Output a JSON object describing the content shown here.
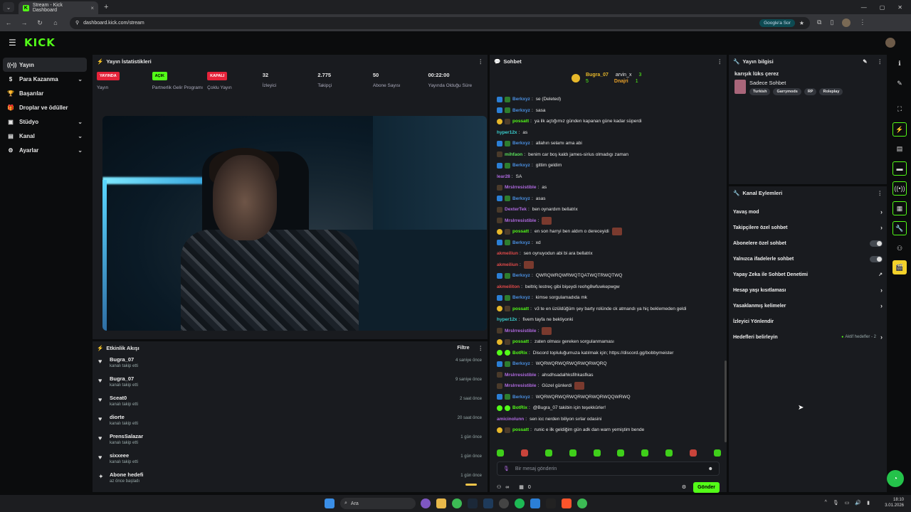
{
  "browser": {
    "tab_title": "Stream - Kick Dashboard",
    "tab_close": "×",
    "new_tab": "+",
    "url": "dashboard.kick.com/stream",
    "google_sor": "Google'a Sor"
  },
  "brand": {
    "logo": "KICK"
  },
  "nav": {
    "items": [
      {
        "label": "Yayın",
        "icon": "broadcast-icon",
        "glyph": "((•))",
        "chevron": ""
      },
      {
        "label": "Para Kazanma",
        "icon": "money-icon",
        "glyph": "$",
        "chevron": "⌄"
      },
      {
        "label": "Başarılar",
        "icon": "trophy-icon",
        "glyph": "🏆",
        "chevron": ""
      },
      {
        "label": "Droplar ve ödüller",
        "icon": "gift-icon",
        "glyph": "🎁",
        "chevron": ""
      },
      {
        "label": "Stüdyo",
        "icon": "studio-icon",
        "glyph": "▣",
        "chevron": "⌄"
      },
      {
        "label": "Kanal",
        "icon": "channel-icon",
        "glyph": "▤",
        "chevron": "⌄"
      },
      {
        "label": "Ayarlar",
        "icon": "gear-icon",
        "glyph": "⚙",
        "chevron": "⌄"
      }
    ]
  },
  "stats": {
    "title": "Yayın İstatistikleri",
    "items": [
      {
        "value": "YAYINDA",
        "label": "Yayın",
        "kind": "badge-red"
      },
      {
        "value": "AÇIK",
        "label": "Partnerlik Gelir Programı",
        "kind": "badge-green"
      },
      {
        "value": "KAPALI",
        "label": "Çoklu Yayın",
        "kind": "badge-red"
      },
      {
        "value": "32",
        "label": "İzleyici",
        "kind": "num"
      },
      {
        "value": "2.775",
        "label": "Takipçi",
        "kind": "num"
      },
      {
        "value": "50",
        "label": "Abone Sayısı",
        "kind": "num"
      },
      {
        "value": "00:22:00",
        "label": "Yayında Olduğu Süre",
        "kind": "num"
      }
    ]
  },
  "feed": {
    "title": "Etkinlik Akışı",
    "filter": "Filtre",
    "items": [
      {
        "name": "Bugra_07",
        "sub": "kanalı takip etti",
        "time": "4 saniye önce",
        "icon": "♥"
      },
      {
        "name": "Bugra_07",
        "sub": "kanalı takip etti",
        "time": "9 saniye önce",
        "icon": "♥"
      },
      {
        "name": "Sceat0",
        "sub": "kanalı takip etti",
        "time": "2 saat önce",
        "icon": "♥"
      },
      {
        "name": "diorte",
        "sub": "kanalı takip etti",
        "time": "20 saat önce",
        "icon": "♥"
      },
      {
        "name": "PrensSalazar",
        "sub": "kanalı takip etti",
        "time": "1 gün önce",
        "icon": "♥"
      },
      {
        "name": "sixxeee",
        "sub": "kanalı takip etti",
        "time": "1 gün önce",
        "icon": "♥"
      },
      {
        "name": "Abone hedefi",
        "sub": "az önce başladı",
        "time": "1 gün önce",
        "icon": "✦"
      }
    ]
  },
  "chat": {
    "title": "Sohbet",
    "top_users": [
      {
        "name": "Bugra_07",
        "count": "5"
      },
      {
        "name": "arvin_x",
        "count": "3"
      },
      {
        "name": "Dnajri",
        "count": "1"
      }
    ],
    "messages": [
      {
        "user": "Berkxyz",
        "color": "#4a8fe0",
        "badges": [
          "mod",
          "sub"
        ],
        "text": "se (Deleted)",
        "emote": false
      },
      {
        "user": "Berkxyz",
        "color": "#4a8fe0",
        "badges": [
          "mod",
          "sub"
        ],
        "text": "sasa",
        "emote": false
      },
      {
        "user": "possatt",
        "color": "#53fc18",
        "badges": [
          "gold",
          "vip"
        ],
        "text": "ya ilk açtığımız günden kapanan güne kadar süperdi",
        "emote": false
      },
      {
        "user": "hyper12x",
        "color": "#3ad0d0",
        "badges": [],
        "text": "as",
        "emote": false
      },
      {
        "user": "Berkxyz",
        "color": "#4a8fe0",
        "badges": [
          "mod",
          "sub"
        ],
        "text": "allahın selamı ama abi",
        "emote": false
      },
      {
        "user": "mihfaon",
        "color": "#5ae05a",
        "badges": [
          "vip"
        ],
        "text": "benim car boş kaldı james-sirius olmadıgı zaman",
        "emote": false
      },
      {
        "user": "Berkxyz",
        "color": "#4a8fe0",
        "badges": [
          "mod",
          "sub"
        ],
        "text": "gittim geldim",
        "emote": false
      },
      {
        "user": "lear28",
        "color": "#b06ae0",
        "badges": [],
        "text": "SA",
        "emote": false
      },
      {
        "user": "Mrslrresistible",
        "color": "#b06ae0",
        "badges": [
          "vip"
        ],
        "text": "as",
        "emote": false
      },
      {
        "user": "Berkxyz",
        "color": "#4a8fe0",
        "badges": [
          "mod",
          "sub"
        ],
        "text": "asas",
        "emote": false
      },
      {
        "user": "DexterTek",
        "color": "#b06ae0",
        "badges": [
          "vip"
        ],
        "text": "ben oynardım bellatrix",
        "emote": false
      },
      {
        "user": "Mrslrresistible",
        "color": "#b06ae0",
        "badges": [
          "vip"
        ],
        "text": "",
        "emote": true
      },
      {
        "user": "possatt",
        "color": "#53fc18",
        "badges": [
          "gold",
          "vip"
        ],
        "text": "en son harryi ben aldım o dereceyidi",
        "emote": true
      },
      {
        "user": "Berkxyz",
        "color": "#4a8fe0",
        "badges": [
          "mod",
          "sub"
        ],
        "text": "xd",
        "emote": false
      },
      {
        "user": "akmeiliun",
        "color": "#e04a4a",
        "badges": [],
        "text": "sen oynuyodun abi bi ara bellatrix",
        "emote": false
      },
      {
        "user": "akmeiliun",
        "color": "#e04a4a",
        "badges": [],
        "text": "",
        "emote": true
      },
      {
        "user": "Berkxyz",
        "color": "#4a8fe0",
        "badges": [
          "mod",
          "sub"
        ],
        "text": "QWRQWRQWRWQTQATWQTRWQTWQ",
        "emote": false
      },
      {
        "user": "akmeiliton",
        "color": "#e04a4a",
        "badges": [],
        "text": "beltriç lestreç gibi bişeydi reohg8wfuwkepwgw",
        "emote": false
      },
      {
        "user": "Berkxyz",
        "color": "#4a8fe0",
        "badges": [
          "mod",
          "sub"
        ],
        "text": "kimse sorgulamadıda mk",
        "emote": false
      },
      {
        "user": "possatt",
        "color": "#53fc18",
        "badges": [
          "gold",
          "vip"
        ],
        "text": "v3 te en üzüldüğüm şey barty rolünde ck atmandı ya hiç beklemeden geldi",
        "emote": false
      },
      {
        "user": "hyper12x",
        "color": "#3ad0d0",
        "badges": [],
        "text": "fivem tayfa ne bekliyonki",
        "emote": false
      },
      {
        "user": "Mrslrresistible",
        "color": "#b06ae0",
        "badges": [
          "vip"
        ],
        "text": "",
        "emote": true
      },
      {
        "user": "possatt",
        "color": "#53fc18",
        "badges": [
          "gold",
          "vip"
        ],
        "text": "zaten olması gereken sorgulanmaması",
        "emote": false
      },
      {
        "user": "BotRix",
        "color": "#53fc18",
        "badges": [
          "bot",
          "bot"
        ],
        "text": "Discord topluluğumuza katılmak için; https://discord.gg/bobbymeister",
        "emote": false
      },
      {
        "user": "Berkxyz",
        "color": "#4a8fe0",
        "badges": [
          "mod",
          "sub"
        ],
        "text": "WQRWQRWQRWQRWQRWQRQ",
        "emote": false
      },
      {
        "user": "Mrslrresistible",
        "color": "#b06ae0",
        "badges": [
          "vip"
        ],
        "text": "ahsdhsadalhksfihkasfkas",
        "emote": false
      },
      {
        "user": "Mrslrresistible",
        "color": "#b06ae0",
        "badges": [
          "vip"
        ],
        "text": "Güzel günlerdi",
        "emote": true
      },
      {
        "user": "Berkxyz",
        "color": "#4a8fe0",
        "badges": [
          "mod",
          "sub"
        ],
        "text": "WQRWQRWQRWQRWQRWQRWQQWRWQ",
        "emote": false
      },
      {
        "user": "BotRix",
        "color": "#53fc18",
        "badges": [
          "bot",
          "bot"
        ],
        "text": "@Bugra_07 takibin için teşekkürler!",
        "emote": false
      },
      {
        "user": "amicinolunn",
        "color": "#b06ae0",
        "badges": [],
        "text": "sen icc nerden biliyon sırlar odasini",
        "emote": false
      },
      {
        "user": "possatt",
        "color": "#53fc18",
        "badges": [
          "gold",
          "vip"
        ],
        "text": "runic e ilk geldiğim gün adk dan warn yemiştim bende",
        "emote": false
      }
    ],
    "input_placeholder": "Bir mesaj gönderin",
    "footer_infinity": "∞",
    "footer_count": "0",
    "send": "Gönder"
  },
  "stream_info": {
    "title": "Yayın bilgisi",
    "stream_title": "karışık lüks çerez",
    "category": "Sadece Sohbet",
    "tags": [
      "Turkish",
      "Garrymods",
      "RP",
      "Roleplay"
    ]
  },
  "channel_actions": {
    "title": "Kanal Eylemleri",
    "items": [
      {
        "label": "Yavaş mod",
        "control": "arrow"
      },
      {
        "label": "Takipçilere özel sohbet",
        "control": "arrow"
      },
      {
        "label": "Abonelere özel sohbet",
        "control": "toggle"
      },
      {
        "label": "Yalnızca ifadelerle sohbet",
        "control": "toggle"
      },
      {
        "label": "Yapay Zeka ile Sohbet Denetimi",
        "control": "external"
      },
      {
        "label": "Hesap yaşı kısıtlaması",
        "control": "arrow"
      },
      {
        "label": "Yasaklanmış kelimeler",
        "control": "arrow"
      },
      {
        "label": "İzleyici Yönlendir",
        "control": "none"
      },
      {
        "label": "Hedefleri belirleyin",
        "control": "arrow",
        "note": "Aktif hedefler - 2"
      }
    ]
  },
  "taskbar": {
    "search": "Ara",
    "time": "18:10",
    "date": "3.01.2026"
  },
  "colors": {
    "accent": "#53fc18",
    "live": "#e5233a",
    "panel": "#191b1f"
  }
}
